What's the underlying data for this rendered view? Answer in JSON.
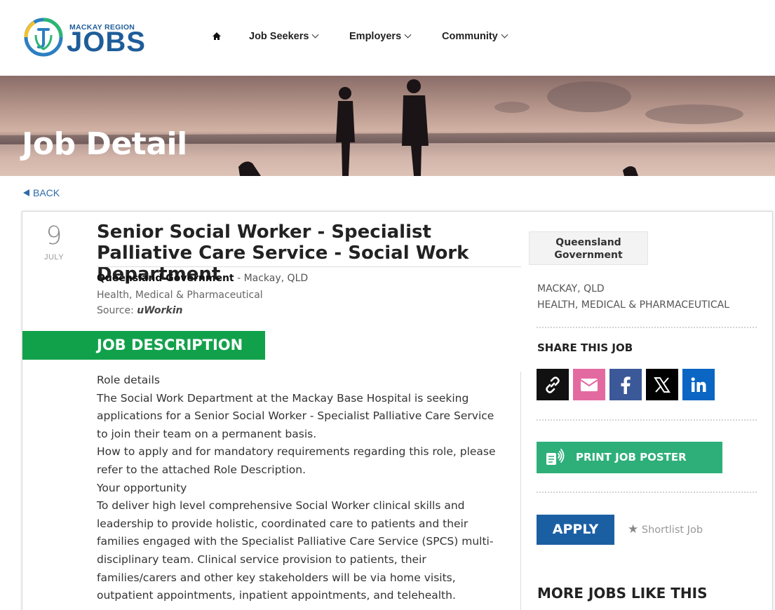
{
  "header": {
    "logo_small": "MACKAY REGION",
    "logo_big": "JOBS",
    "nav": {
      "home_icon": "home-icon",
      "job_seekers": "Job Seekers",
      "employers": "Employers",
      "community": "Community"
    }
  },
  "banner": {
    "title": "Job Detail"
  },
  "back_label": "BACK",
  "job": {
    "day": "9",
    "month": "JULY",
    "title": "Senior Social Worker - Specialist Palliative Care Service - Social Work Department",
    "company": "Queensland Government",
    "location_suffix": " - Mackay, QLD",
    "category": "Health, Medical & Pharmaceutical",
    "source_label": "Source: ",
    "source": "uWorkin"
  },
  "description": {
    "heading": "JOB DESCRIPTION",
    "paragraphs": [
      "Role details",
      "The Social Work Department at the Mackay Base Hospital is seeking applications for a Senior Social Worker - Specialist Palliative Care Service to join their team on a permanent basis.",
      "How to apply and for mandatory requirements regarding this role, please refer to the attached Role Description.",
      "Your opportunity",
      "To deliver high level comprehensive Social Worker clinical skills and leadership to provide holistic, coordinated care to patients and their families engaged with the Specialist Palliative Care Service (SPCS) multi-disciplinary team. Clinical service provision to patients, their families/carers and other key stakeholders will be via home visits, outpatient appointments, inpatient appointments, and telehealth."
    ]
  },
  "sidebar": {
    "company_box": "Queensland Government",
    "location": "MACKAY, QLD",
    "category": "HEALTH, MEDICAL & PHARMACEUTICAL",
    "share_heading": "SHARE THIS JOB",
    "share_icons": [
      "link-icon",
      "email-icon",
      "facebook-icon",
      "x-icon",
      "linkedin-icon"
    ],
    "share_colors": [
      "#111111",
      "#e36aa1",
      "#3b5998",
      "#000000",
      "#0a66c2"
    ],
    "print_label": "PRINT JOB POSTER",
    "apply_label": "APPLY",
    "shortlist_label": "Shortlist Job",
    "more_heading": "MORE JOBS LIKE THIS"
  },
  "colors": {
    "brand_blue": "#1e5d99",
    "green": "#12a14b",
    "print_green": "#2eaf79",
    "apply_blue": "#1b5fa3"
  }
}
